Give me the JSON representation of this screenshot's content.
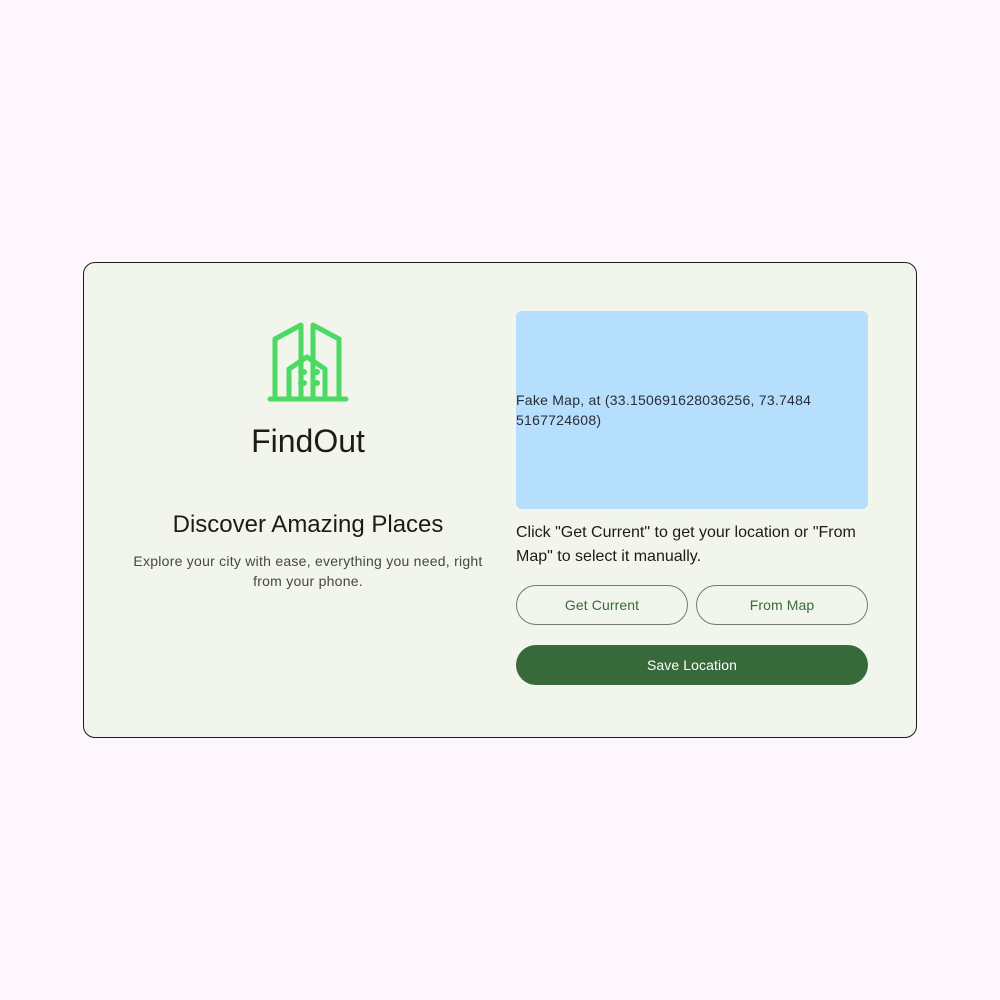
{
  "app": {
    "name": "FindOut",
    "logo_icon": "building-icon",
    "logo_color": "#4cd964"
  },
  "hero": {
    "title": "Discover Amazing Places",
    "subtitle": "Explore your city with ease, everything you need, right from your phone."
  },
  "map": {
    "label": "Fake Map, at (33.150691628036256, 73.74845167724608)",
    "background": "#b6defd"
  },
  "location": {
    "instructions": "Click \"Get Current\" to get your location or \"From Map\" to select it manually.",
    "get_current_label": "Get Current",
    "from_map_label": "From Map",
    "save_label": "Save Location"
  },
  "colors": {
    "page_background": "#fdf7fd",
    "card_background": "#f2f5ec",
    "primary": "#37693b"
  }
}
